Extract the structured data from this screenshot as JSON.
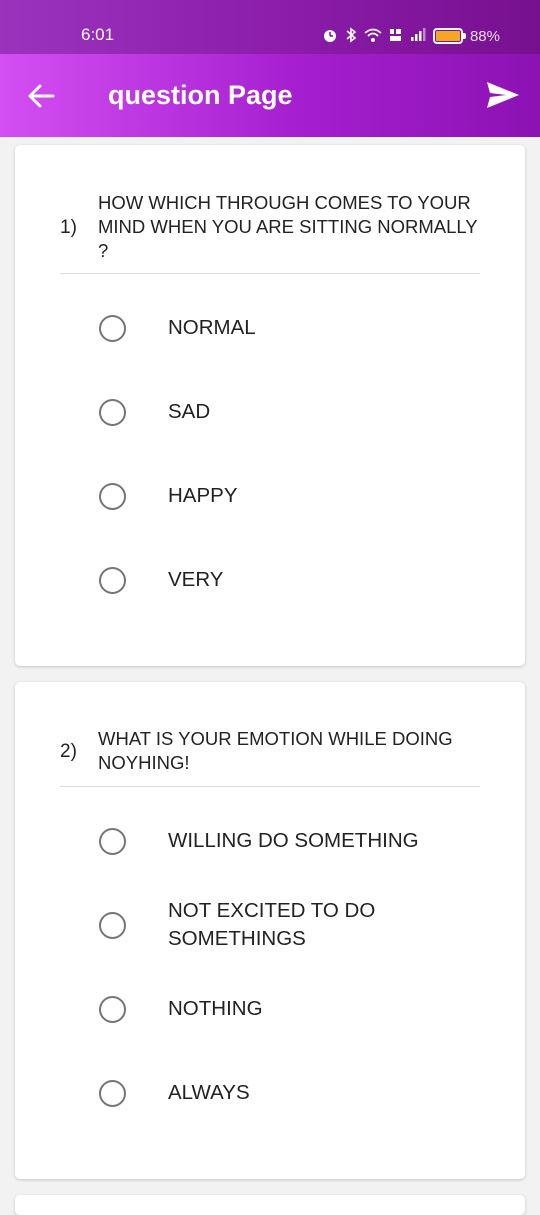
{
  "status_bar": {
    "time": "6:01",
    "icons": [
      "alarm-icon",
      "bluetooth-icon",
      "wifi-icon",
      "volte-icon",
      "signal-icon",
      "battery-icon"
    ],
    "battery": "88%"
  },
  "appbar": {
    "title": "question Page",
    "back_icon": "arrow-left-icon",
    "send_icon": "send-icon"
  },
  "colors": {
    "header_start": "#d44ff2",
    "header_end": "#8c12b3",
    "radio_border": "#757575",
    "background": "#f2f2f2"
  },
  "questions": [
    {
      "number": "1)",
      "text": "HOW WHICH THROUGH COMES TO YOUR MIND WHEN YOU ARE SITTING NORMALLY ?",
      "options": [
        "NORMAL",
        "SAD",
        "HAPPY",
        "VERY"
      ]
    },
    {
      "number": "2)",
      "text": "WHAT IS YOUR EMOTION WHILE DOING NOYHING!",
      "options": [
        "WILLING DO SOMETHING",
        "NOT EXCITED TO DO SOMETHINGS",
        "NOTHING",
        "ALWAYS"
      ]
    }
  ]
}
